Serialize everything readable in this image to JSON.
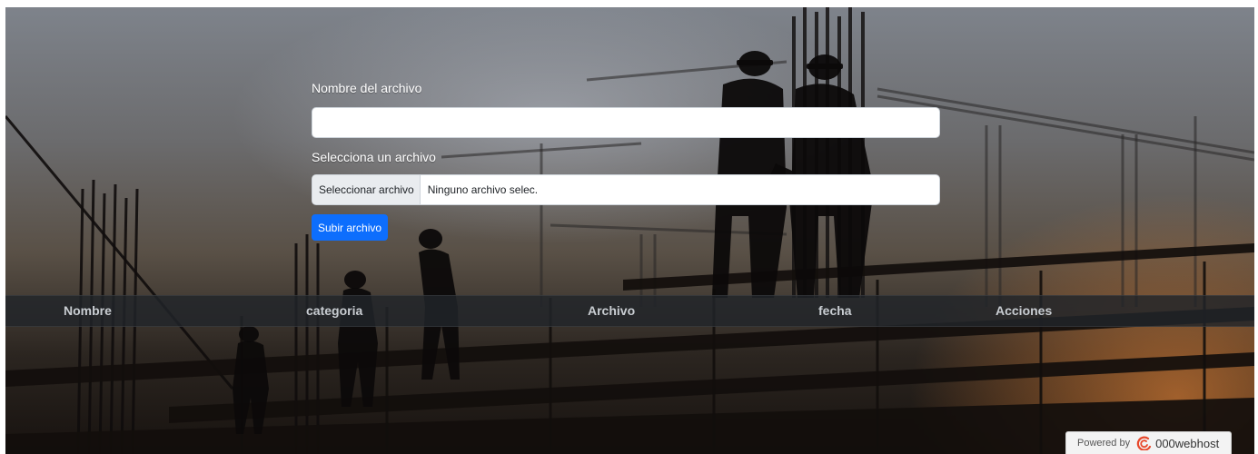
{
  "form": {
    "file_name_label": "Nombre del archivo",
    "file_name_value": "",
    "select_file_label": "Selecciona un archivo",
    "file_button_label": "Seleccionar archivo",
    "file_status": "Ninguno archivo selec.",
    "submit_label": "Subir archivo"
  },
  "table": {
    "headers": [
      "Nombre",
      "categoria",
      "Archivo",
      "fecha",
      "Acciones"
    ]
  },
  "footer": {
    "powered_by": "Powered by",
    "brand": "000webhost",
    "logo_icon": "000webhost-logo-icon"
  },
  "colors": {
    "primary_button": "#0d6efd",
    "table_header_bg": "#212529",
    "brand_accent": "#e8482b"
  }
}
